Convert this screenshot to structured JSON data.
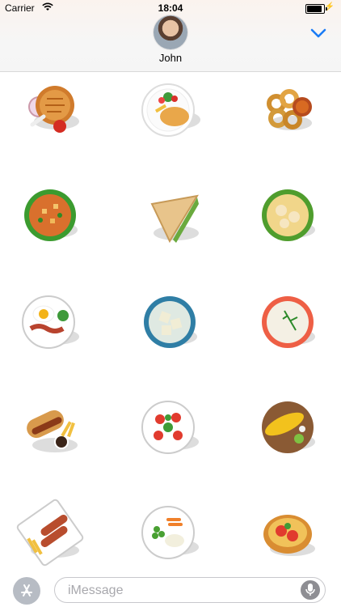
{
  "status_bar": {
    "carrier": "Carrier",
    "time": "18:04",
    "battery_level": 1.0
  },
  "header": {
    "contact_name": "John",
    "collapse_icon": "chevron-down-icon"
  },
  "stickers": [
    {
      "name": "roast-chicken-sticker"
    },
    {
      "name": "schnitzel-plate-sticker"
    },
    {
      "name": "onion-rings-sticker"
    },
    {
      "name": "vegetable-soup-sticker"
    },
    {
      "name": "sandwich-sticker"
    },
    {
      "name": "pasta-bowl-sticker"
    },
    {
      "name": "egg-bacon-breakfast-sticker"
    },
    {
      "name": "ravioli-bowl-sticker"
    },
    {
      "name": "mashed-potatoes-sticker"
    },
    {
      "name": "hot-dog-fries-sticker"
    },
    {
      "name": "caprese-salad-sticker"
    },
    {
      "name": "corn-cob-board-sticker"
    },
    {
      "name": "sausages-fries-sticker"
    },
    {
      "name": "peas-carrots-plate-sticker"
    },
    {
      "name": "tomato-bruschetta-sticker"
    }
  ],
  "compose": {
    "placeholder": "iMessage",
    "app_store_icon": "app-store-icon",
    "mic_icon": "microphone-icon"
  }
}
